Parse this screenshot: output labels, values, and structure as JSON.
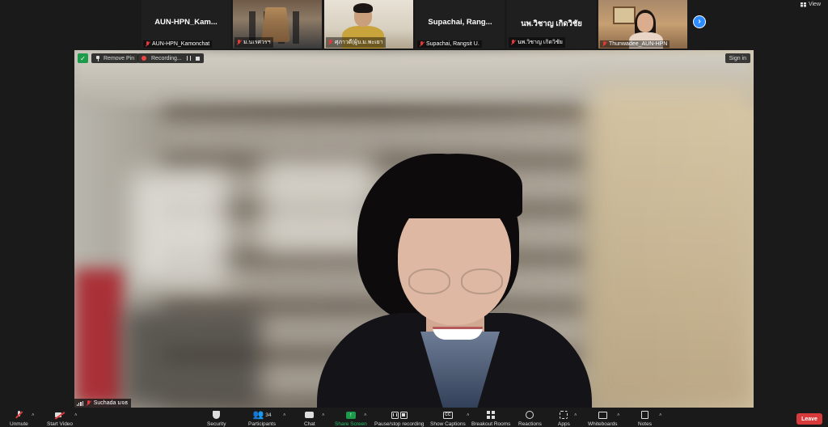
{
  "top_bar": {
    "view_label": "View",
    "next_page_icon": "chevron-right-icon"
  },
  "participants": [
    {
      "display_name": "AUN-HPN_Kam...",
      "label": "AUN-HPN_Kamonchat",
      "muted": true,
      "video": false
    },
    {
      "display_name": "",
      "label": "ม.นเรศวรฯ",
      "muted": true,
      "video": true
    },
    {
      "display_name": "",
      "label": "ศุภาวดี(ผู้บ.ม.พะเยา",
      "muted": true,
      "video": true
    },
    {
      "display_name": "Supachai, Rang...",
      "label": "Supachai, Rangsit U.",
      "muted": true,
      "video": false
    },
    {
      "display_name": "นพ.วิชาญ เกิดวิชัย",
      "label": "นพ.วิชาญ เกิดวิชัย",
      "muted": true,
      "video": false
    },
    {
      "display_name": "",
      "label": "Thunwadee_AUN-HPN",
      "muted": true,
      "video": true
    }
  ],
  "main_video": {
    "remove_pin_label": "Remove Pin",
    "recording_label": "Recording...",
    "sign_in_label": "Sign in",
    "speaker_name": "Suchada มจธ",
    "speaker_muted": true
  },
  "toolbar": {
    "unmute": "Unmute",
    "start_video": "Start Video",
    "security": "Security",
    "participants": "Participants",
    "participants_count": "34",
    "chat": "Chat",
    "share_screen": "Share Screen",
    "pause_stop_recording": "Pause/stop recording",
    "show_captions": "Show Captions",
    "breakout_rooms": "Breakout Rooms",
    "reactions": "Reactions",
    "apps": "Apps",
    "whiteboards": "Whiteboards",
    "notes": "Notes",
    "leave": "Leave"
  },
  "colors": {
    "background": "#1a1a1a",
    "accent_blue": "#2d8cff",
    "share_green": "#1c9c4a",
    "leave_red": "#d63a3a",
    "muted_red": "#e03b3b"
  }
}
